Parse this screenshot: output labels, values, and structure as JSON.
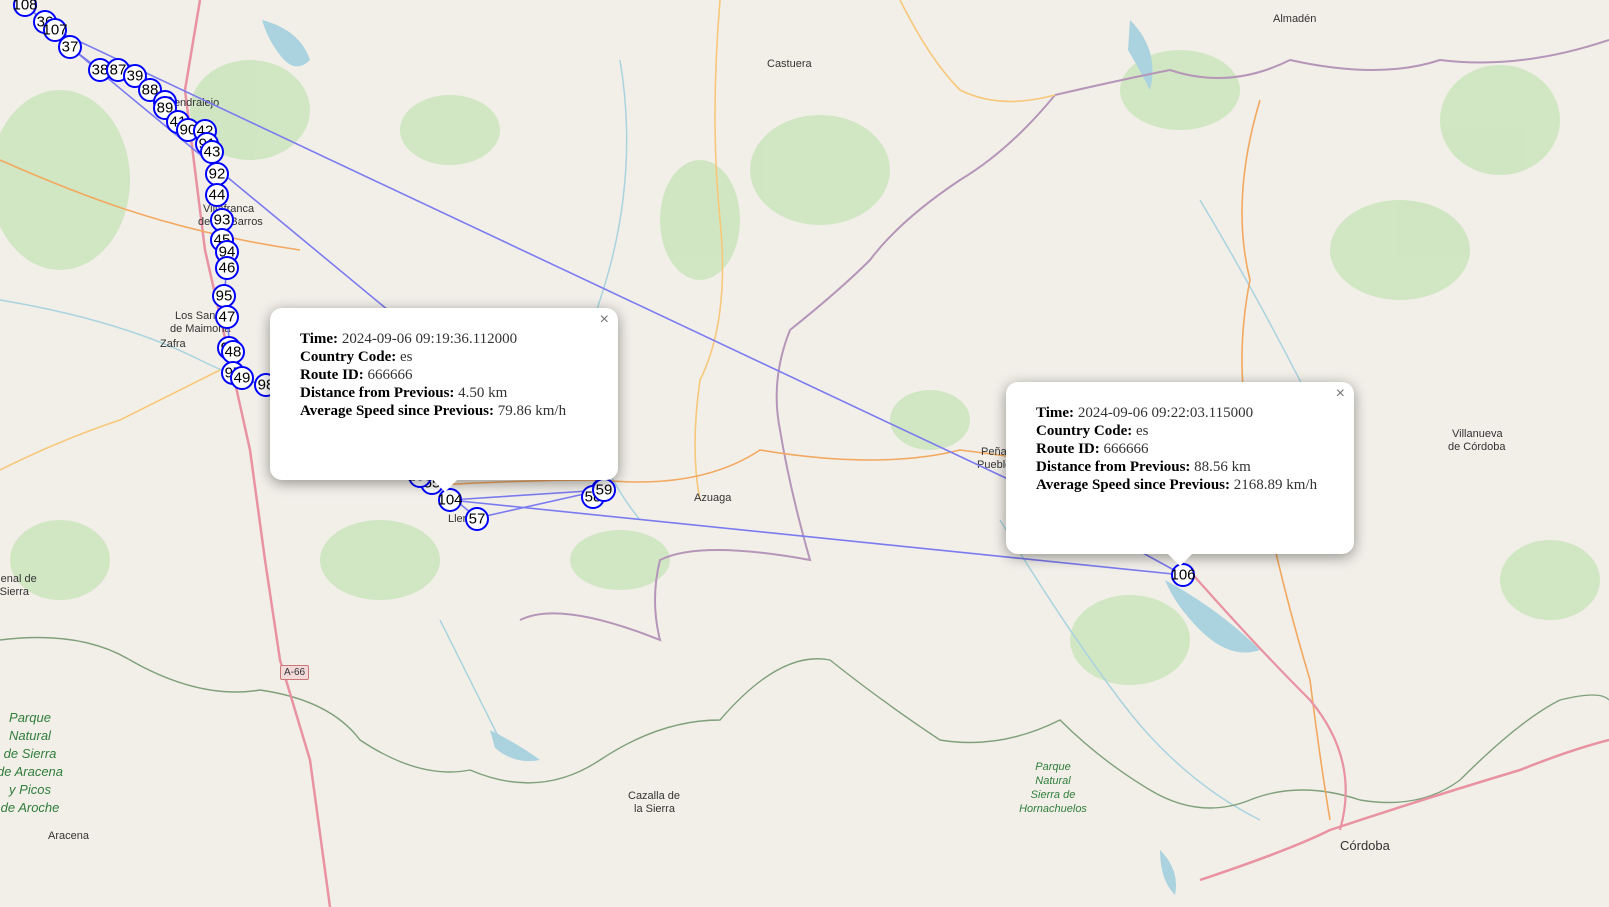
{
  "map": {
    "places": [
      {
        "name": "Almadén"
      },
      {
        "name": "Castuera"
      },
      {
        "name": "Almendralejo"
      },
      {
        "name": "Villafranca"
      },
      {
        "name": "de los Barros"
      },
      {
        "name": "Los Santos"
      },
      {
        "name": "de Maimona"
      },
      {
        "name": "Zafra"
      },
      {
        "name": "Azuaga"
      },
      {
        "name": "Llerena"
      },
      {
        "name": "Peñarroya-"
      },
      {
        "name": "Pueblonuevo"
      },
      {
        "name": "Villanueva"
      },
      {
        "name": "de Córdoba"
      },
      {
        "name": "Cazalla de"
      },
      {
        "name": "la Sierra"
      },
      {
        "name": "Córdoba"
      },
      {
        "name": "Aracena"
      },
      {
        "name": "Fregenal de"
      },
      {
        "name": "la Sierra"
      }
    ],
    "parks": [
      {
        "lines": [
          "Parque",
          "Natural",
          "de Sierra",
          "de Aracena",
          "y Picos",
          "de Aroche"
        ]
      },
      {
        "lines": [
          "Parque",
          "Natural",
          "Sierra de",
          "Hornachuelos"
        ]
      }
    ],
    "road_shield": "A-66",
    "marker_colors": {
      "stroke": "#0000ff",
      "fill": "#ffffff",
      "route": "#7b7bf0"
    },
    "markers": [
      {
        "label": "108"
      },
      {
        "label": "36"
      },
      {
        "label": "107"
      },
      {
        "label": "37"
      },
      {
        "label": "38"
      },
      {
        "label": "87"
      },
      {
        "label": "39"
      },
      {
        "label": "88"
      },
      {
        "label": "40"
      },
      {
        "label": "89"
      },
      {
        "label": "41"
      },
      {
        "label": "90"
      },
      {
        "label": "42"
      },
      {
        "label": "91"
      },
      {
        "label": "43"
      },
      {
        "label": "92"
      },
      {
        "label": "44"
      },
      {
        "label": "93"
      },
      {
        "label": "45"
      },
      {
        "label": "94"
      },
      {
        "label": "46"
      },
      {
        "label": "95"
      },
      {
        "label": "47"
      },
      {
        "label": "96"
      },
      {
        "label": "48"
      },
      {
        "label": "97"
      },
      {
        "label": "49"
      },
      {
        "label": "98"
      },
      {
        "label": "55"
      },
      {
        "label": "103"
      },
      {
        "label": "56"
      },
      {
        "label": "104"
      },
      {
        "label": "57"
      },
      {
        "label": "58"
      },
      {
        "label": "59"
      },
      {
        "label": "106"
      }
    ]
  },
  "popups": [
    {
      "close": "×",
      "time_label": "Time:",
      "time": "2024-09-06 09:19:36.112000",
      "country_label": "Country Code:",
      "country": "es",
      "route_label": "Route ID:",
      "route": "666666",
      "distance_label": "Distance from Previous:",
      "distance": "4.50 km",
      "speed_label": "Average Speed since Previous:",
      "speed": "79.86 km/h"
    },
    {
      "close": "×",
      "time_label": "Time:",
      "time": "2024-09-06 09:22:03.115000",
      "country_label": "Country Code:",
      "country": "es",
      "route_label": "Route ID:",
      "route": "666666",
      "distance_label": "Distance from Previous:",
      "distance": "88.56 km",
      "speed_label": "Average Speed since Previous:",
      "speed": "2168.89 km/h"
    }
  ]
}
